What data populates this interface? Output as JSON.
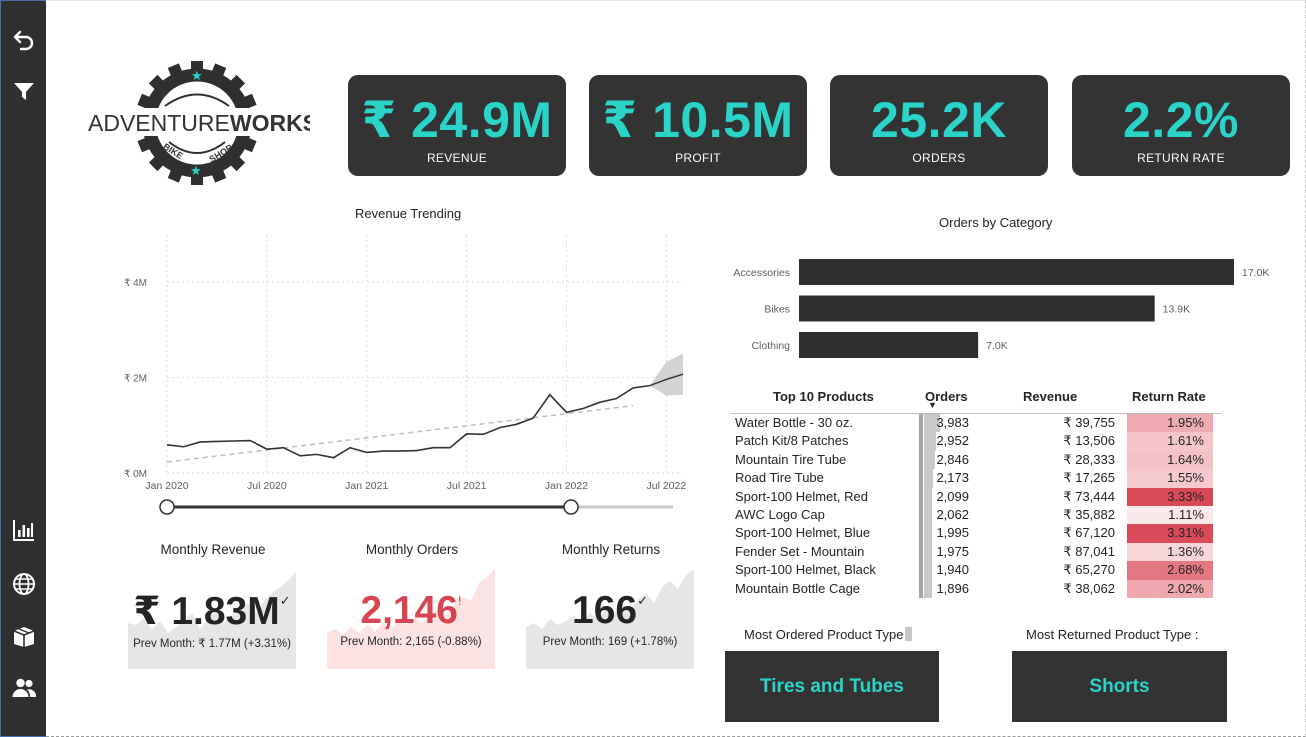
{
  "brand": {
    "logo_text_light": "ADVENTURE",
    "logo_text_bold": "WORKS",
    "logo_sub_left": "BIKE",
    "logo_sub_right": "SHOP",
    "accent": "#2ad4c8",
    "card_bg": "#333333"
  },
  "nav": {
    "icons": [
      "back-arrow-icon",
      "filter-icon",
      "bar-chart-icon",
      "globe-icon",
      "box-icon",
      "users-icon"
    ]
  },
  "kpis": [
    {
      "value": "₹ 24.9M",
      "label": "REVENUE"
    },
    {
      "value": "₹ 10.5M",
      "label": "PROFIT"
    },
    {
      "value": "25.2K",
      "label": "ORDERS"
    },
    {
      "value": "2.2%",
      "label": "RETURN RATE"
    }
  ],
  "revenue_trend": {
    "title": "Revenue Trending",
    "y_ticks": [
      "₹ 0M",
      "₹ 2M",
      "₹ 4M"
    ],
    "x_ticks": [
      "Jan 2020",
      "Jul 2020",
      "Jan 2021",
      "Jul 2021",
      "Jan 2022",
      "Jul 2022"
    ]
  },
  "chart_data": [
    {
      "type": "line",
      "title": "Revenue Trending",
      "ylim": [
        0,
        4000000
      ],
      "y_ticks": [
        0,
        2000000,
        4000000
      ],
      "x_ticks": [
        "Jan 2020",
        "Jul 2020",
        "Jan 2021",
        "Jul 2021",
        "Jan 2022",
        "Jul 2022"
      ],
      "x": [
        "2020-01",
        "2020-02",
        "2020-03",
        "2020-04",
        "2020-05",
        "2020-06",
        "2020-07",
        "2020-08",
        "2020-09",
        "2020-10",
        "2020-11",
        "2020-12",
        "2021-01",
        "2021-02",
        "2021-03",
        "2021-04",
        "2021-05",
        "2021-06",
        "2021-07",
        "2021-08",
        "2021-09",
        "2021-10",
        "2021-11",
        "2021-12",
        "2022-01",
        "2022-02",
        "2022-03",
        "2022-04",
        "2022-05",
        "2022-06"
      ],
      "series": [
        {
          "values": [
            590000,
            550000,
            650000,
            660000,
            670000,
            680000,
            500000,
            530000,
            360000,
            390000,
            320000,
            530000,
            430000,
            460000,
            460000,
            470000,
            530000,
            530000,
            820000,
            810000,
            950000,
            1020000,
            1150000,
            1640000,
            1270000,
            1350000,
            1480000,
            1560000,
            1780000,
            1830000
          ]
        }
      ],
      "trend_line": {
        "from": 230000,
        "to": 1410000
      },
      "forecast": {
        "x": [
          "2022-07",
          "2022-08"
        ],
        "values": [
          1960000,
          2070000
        ],
        "upper": [
          2330000,
          2500000
        ],
        "lower": [
          1620000,
          1640000
        ]
      }
    },
    {
      "type": "bar",
      "title": "Orders by Category",
      "categories": [
        "Accessories",
        "Bikes",
        "Clothing"
      ],
      "values": [
        17000,
        13900,
        7000
      ],
      "labels": [
        "17.0K",
        "13.9K",
        "7.0K"
      ]
    },
    {
      "type": "table",
      "title": "Top 10 Products",
      "columns": [
        "Top 10 Products",
        "Orders",
        "Revenue",
        "Return Rate"
      ],
      "rows": [
        {
          "product": "Water Bottle - 30 oz.",
          "orders": "3,983",
          "orders_num": 3983,
          "revenue": "₹ 39,755",
          "return_rate": "1.95%",
          "rr_num": 1.95
        },
        {
          "product": "Patch Kit/8 Patches",
          "orders": "2,952",
          "orders_num": 2952,
          "revenue": "₹ 13,506",
          "return_rate": "1.61%",
          "rr_num": 1.61
        },
        {
          "product": "Mountain Tire Tube",
          "orders": "2,846",
          "orders_num": 2846,
          "revenue": "₹ 28,333",
          "return_rate": "1.64%",
          "rr_num": 1.64
        },
        {
          "product": "Road Tire Tube",
          "orders": "2,173",
          "orders_num": 2173,
          "revenue": "₹ 17,265",
          "return_rate": "1.55%",
          "rr_num": 1.55
        },
        {
          "product": "Sport-100 Helmet, Red",
          "orders": "2,099",
          "orders_num": 2099,
          "revenue": "₹ 73,444",
          "return_rate": "3.33%",
          "rr_num": 3.33
        },
        {
          "product": "AWC Logo Cap",
          "orders": "2,062",
          "orders_num": 2062,
          "revenue": "₹ 35,882",
          "return_rate": "1.11%",
          "rr_num": 1.11
        },
        {
          "product": "Sport-100 Helmet, Blue",
          "orders": "1,995",
          "orders_num": 1995,
          "revenue": "₹ 67,120",
          "return_rate": "3.31%",
          "rr_num": 3.31
        },
        {
          "product": "Fender Set - Mountain",
          "orders": "1,975",
          "orders_num": 1975,
          "revenue": "₹ 87,041",
          "return_rate": "1.36%",
          "rr_num": 1.36
        },
        {
          "product": "Sport-100 Helmet, Black",
          "orders": "1,940",
          "orders_num": 1940,
          "revenue": "₹ 65,270",
          "return_rate": "2.68%",
          "rr_num": 2.68
        },
        {
          "product": "Mountain Bottle Cage",
          "orders": "1,896",
          "orders_num": 1896,
          "revenue": "₹ 38,062",
          "return_rate": "2.02%",
          "rr_num": 2.02
        }
      ]
    }
  ],
  "monthly": [
    {
      "title": "Monthly Revenue",
      "value": "₹ 1.83M",
      "mark": "✓",
      "prev": "Prev Month: ₹ 1.77M (+3.31%)",
      "value_color": "#252423",
      "area_color": "#e6e6e6"
    },
    {
      "title": "Monthly Orders",
      "value": "2,146",
      "mark": "!",
      "prev": "Prev Month: 2,165 (-0.88%)",
      "value_color": "#d64550",
      "area_color": "#fbe3e4"
    },
    {
      "title": "Monthly Returns",
      "value": "166",
      "mark": "✓",
      "prev": "Prev Month: 169 (+1.78%)",
      "value_color": "#252423",
      "area_color": "#e6e6e6"
    }
  ],
  "most_ordered": {
    "label": "Most Ordered Product Type",
    "value": "Tires and Tubes"
  },
  "most_returned": {
    "label": "Most Returned Product Type :",
    "value": "Shorts"
  }
}
